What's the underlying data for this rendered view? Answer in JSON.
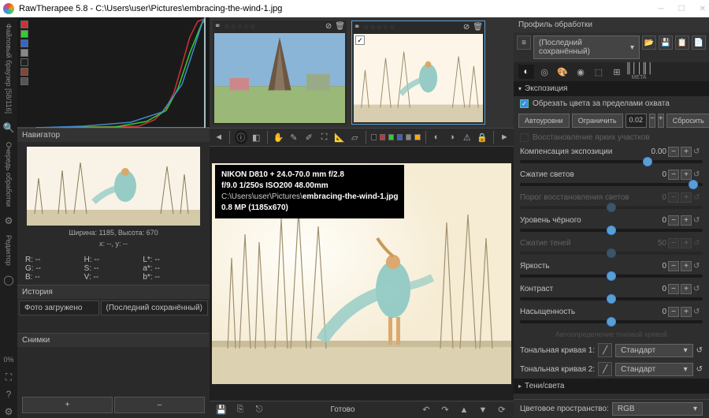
{
  "title": "RawTherapee 5.8 - C:\\Users\\user\\Pictures\\embracing-the-wind-1.jpg",
  "left_tabs": [
    "Файловый браузер [58/116]",
    "Очередь обработки",
    "Редактор"
  ],
  "navigator": {
    "hdr": "Навигатор",
    "dims": "Ширина: 1185, Высота: 670",
    "xy": "x: --, y: --",
    "rows": [
      "R:",
      "G:",
      "B:",
      "S:",
      "V:",
      "H:",
      "L*:",
      "a*:",
      "b*:"
    ]
  },
  "history": {
    "hdr": "История",
    "item": "Фото загружено",
    "profile": "(Последний сохранённый)"
  },
  "snapshots": {
    "hdr": "Снимки",
    "plus": "+",
    "minus": "–"
  },
  "overlay": {
    "l1a": "NIKON D810 + 24.0-70.0 mm f/2.8",
    "l2": "f/9.0  1/250s  ISO200  48.00mm",
    "l3a": "C:\\Users\\user\\Pictures\\",
    "l3b": "embracing-the-wind-1.jpg",
    "l4": "0.8 MP (1185x670)"
  },
  "status": "Готово",
  "right": {
    "profile_hdr": "Профиль обработки",
    "profile_sel": "(Последний сохранённый)",
    "meta": "META",
    "exposure": "Экспозиция",
    "clip_chk": "Обрезать цвета за пределами охвата",
    "autolevels": "Автоуровни",
    "clip": "Ограничить",
    "clip_v": "0.02",
    "reset": "Сбросить",
    "hlr": "Восстановление ярких участков",
    "sliders": [
      {
        "label": "Компенсация экспозиции",
        "val": "0.00",
        "pos": 70,
        "en": true
      },
      {
        "label": "Сжатие светов",
        "val": "0",
        "pos": 95,
        "en": true
      },
      {
        "label": "Порог восстановления светов",
        "val": "0",
        "pos": 50,
        "en": false
      },
      {
        "label": "Уровень чёрного",
        "val": "0",
        "pos": 50,
        "en": true
      },
      {
        "label": "Сжатие теней",
        "val": "50",
        "pos": 50,
        "en": false
      },
      {
        "label": "Яркость",
        "val": "0",
        "pos": 50,
        "en": true
      },
      {
        "label": "Контраст",
        "val": "0",
        "pos": 50,
        "en": true
      },
      {
        "label": "Насыщенность",
        "val": "0",
        "pos": 50,
        "en": true
      }
    ],
    "auto_tone": "Автоопределение тоновой кривой",
    "curve1": "Тональная кривая 1:",
    "curve2": "Тональная кривая 2:",
    "curve_std": "Стандарт",
    "shadows": "Тени/света",
    "colorspace_l": "Цветовое пространство:",
    "colorspace_v": "RGB"
  }
}
